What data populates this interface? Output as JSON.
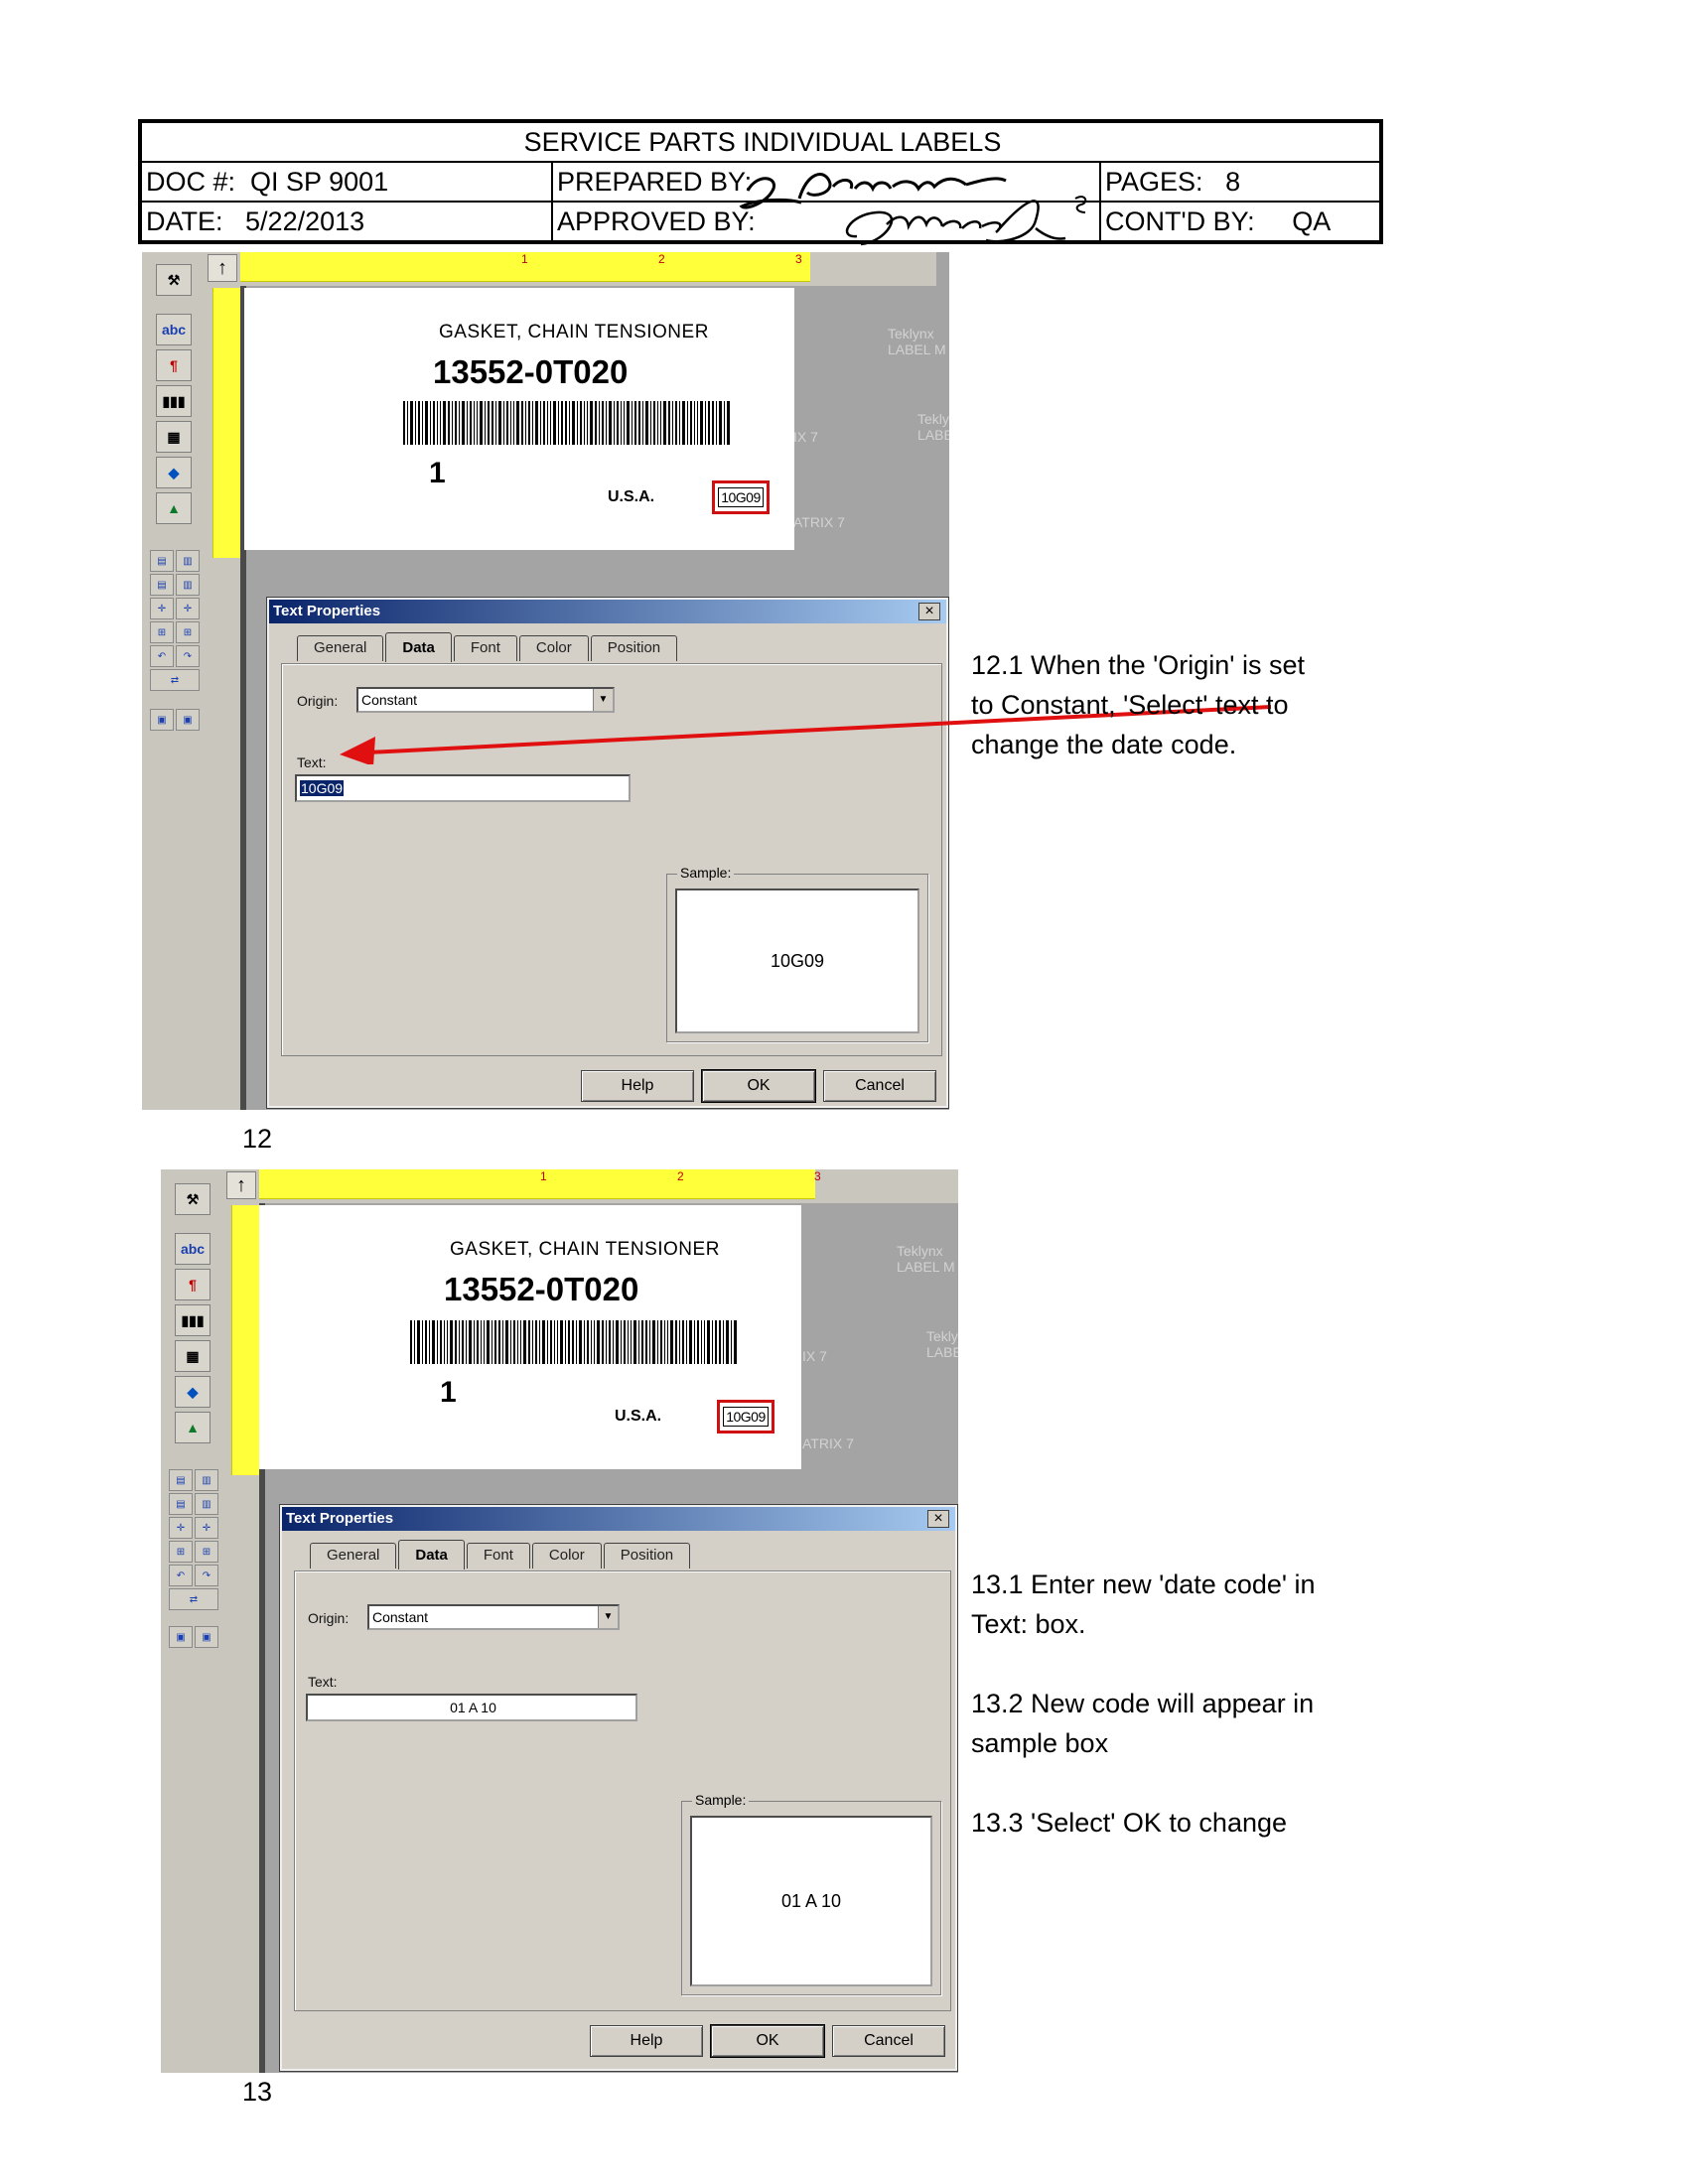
{
  "header": {
    "title": "SERVICE PARTS INDIVIDUAL LABELS",
    "doc_label": "DOC #:",
    "doc_value": "QI SP 9001",
    "prepared_label": "PREPARED BY:",
    "pages_label": "PAGES:",
    "pages_value": "8",
    "date_label": "DATE:",
    "date_value": "5/22/2013",
    "approved_label": "APPROVED BY:",
    "contd_label": "CONT'D BY:",
    "contd_value": "QA"
  },
  "label_preview": {
    "description": "GASKET, CHAIN TENSIONER",
    "part_number": "13552-0T020",
    "quantity": "1",
    "country": "U.S.A.",
    "date_code": "10G09",
    "watermark_lines": [
      "Teklynx",
      "LABEL M",
      "Tekly",
      "LABE",
      "IX 7",
      "ATRIX 7"
    ],
    "ruler_marks": [
      "1",
      "2",
      "3"
    ]
  },
  "toolbar": {
    "abc_label": "abc"
  },
  "dialog": {
    "title": "Text Properties",
    "close_label": "×",
    "tabs": [
      "General",
      "Data",
      "Font",
      "Color",
      "Position"
    ],
    "origin_label": "Origin:",
    "origin_value": "Constant",
    "text_label": "Text:",
    "sample_label": "Sample:",
    "buttons": {
      "help": "Help",
      "ok": "OK",
      "cancel": "Cancel"
    }
  },
  "steps": [
    {
      "number": "12",
      "text_value": "10G09",
      "sample_value": "10G09",
      "notes": [
        "12.1 When the 'Origin' is set",
        "to Constant, 'Select' text to",
        "change the date code."
      ]
    },
    {
      "number": "13",
      "text_value": "01 A 10",
      "sample_value": "01 A 10",
      "notes": [
        "13.1 Enter new 'date code' in",
        "Text: box.",
        "13.2 New code will appear in",
        "sample box",
        "13.3 'Select' OK to change"
      ]
    }
  ],
  "colors": {
    "arrow": "#e01010",
    "ruler": "#ffff3a",
    "titlebar": "#0a246a"
  }
}
